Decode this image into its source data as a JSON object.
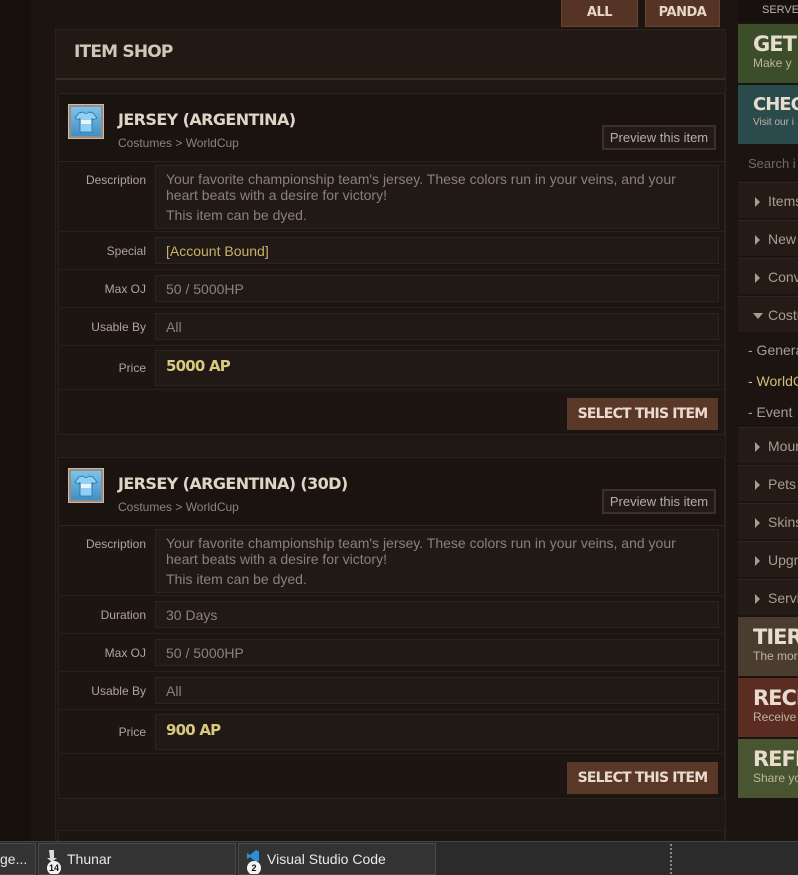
{
  "filters": {
    "all_classes": "ALL CLASSES",
    "panda_only": "PANDA ONLY"
  },
  "shop": {
    "title": "ITEM SHOP"
  },
  "items": [
    {
      "title": "JERSEY (ARGENTINA)",
      "category": "Costumes > WorldCup",
      "preview": "Preview this item",
      "description": "Your favorite championship team's jersey. These colors run in your veins, and your heart beats with a desire for victory!",
      "description2": "This item can be dyed.",
      "extra_label": "Special",
      "extra_value": "[Account Bound]",
      "labels": {
        "description": "Description",
        "max_oj": "Max OJ",
        "usable_by": "Usable By",
        "price": "Price"
      },
      "max_oj": "50 / 5000HP",
      "usable_by": "All",
      "price": "5000 AP",
      "select": "SELECT THIS ITEM"
    },
    {
      "title": "JERSEY (ARGENTINA) (30D)",
      "category": "Costumes > WorldCup",
      "preview": "Preview this item",
      "description": "Your favorite championship team's jersey. These colors run in your veins, and your heart beats with a desire for victory!",
      "description2": "This item can be dyed.",
      "extra_label": "Duration",
      "extra_value": "30 Days",
      "labels": {
        "description": "Description",
        "max_oj": "Max OJ",
        "usable_by": "Usable By",
        "price": "Price"
      },
      "max_oj": "50 / 5000HP",
      "usable_by": "All",
      "price": "900 AP",
      "select": "SELECT THIS ITEM"
    }
  ],
  "sidebar": {
    "top": "SERVE",
    "card_get_big": "GET I",
    "card_get_small": "Make y",
    "card_check_big": "CHECK",
    "card_check_small": "Visit our i",
    "search": "Search i",
    "nav": [
      "Items",
      "New",
      "Conv",
      "Costu"
    ],
    "sub": [
      "- Genera",
      "- WorldC",
      "- Event"
    ],
    "nav2": [
      "Moun",
      "Pets",
      "Skins",
      "Upgr",
      "Servi"
    ],
    "card_tiered_big": "TIERED",
    "card_tiered_small": "The more",
    "card_recru_big": "RECRU",
    "card_recru_small": "Receive i",
    "card_refer_big": "REFER",
    "card_refer_small": "Share yo"
  },
  "taskbar": {
    "t0": "ge...",
    "t1": "Thunar",
    "t1_badge": "14",
    "t2": "Visual Studio Code",
    "t2_badge": "2"
  }
}
